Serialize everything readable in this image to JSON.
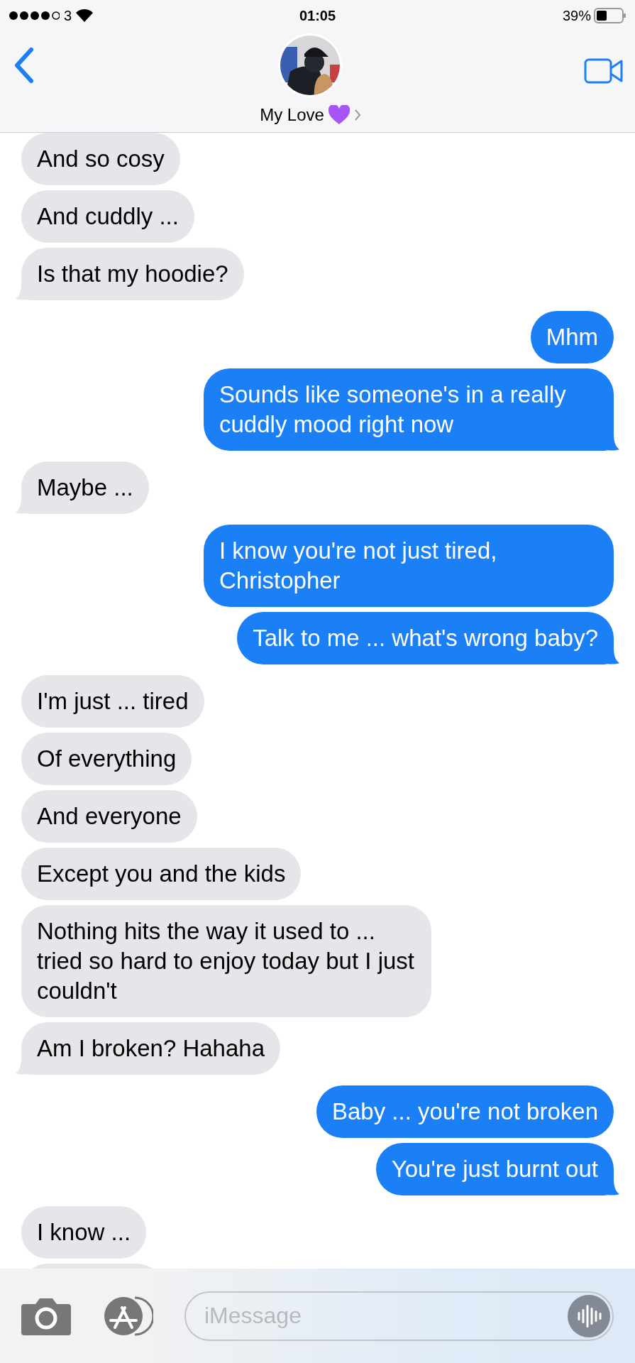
{
  "status_bar": {
    "carrier": "3",
    "time": "01:05",
    "battery": "39%"
  },
  "header": {
    "contact_name": "My Love"
  },
  "messages": [
    {
      "kind": "received",
      "text": "And so cosy",
      "tail": false
    },
    {
      "kind": "received",
      "text": "And cuddly ...",
      "tail": false
    },
    {
      "kind": "received",
      "text": "Is that my hoodie?",
      "tail": true
    },
    {
      "kind": "sent",
      "text": "Mhm",
      "tail": false
    },
    {
      "kind": "sent",
      "text": "Sounds like someone's in a really cuddly mood right now",
      "tail": true
    },
    {
      "kind": "received",
      "text": "Maybe ...",
      "tail": true
    },
    {
      "kind": "sent",
      "text": "I know you're not just tired, Christopher",
      "tail": false
    },
    {
      "kind": "sent",
      "text": "Talk to me ... what's wrong baby?",
      "tail": true
    },
    {
      "kind": "received",
      "text": "I'm just ... tired",
      "tail": false
    },
    {
      "kind": "received",
      "text": "Of everything",
      "tail": false
    },
    {
      "kind": "received",
      "text": "And everyone",
      "tail": false
    },
    {
      "kind": "received",
      "text": "Except you and the kids",
      "tail": false
    },
    {
      "kind": "received",
      "text": "Nothing hits the way it used to ... tried so hard to enjoy today but I just couldn't",
      "tail": false
    },
    {
      "kind": "received",
      "text": "Am I broken? Hahaha",
      "tail": true
    },
    {
      "kind": "sent",
      "text": "Baby ... you're not broken",
      "tail": false
    },
    {
      "kind": "sent",
      "text": "You're just burnt out",
      "tail": true
    },
    {
      "kind": "received",
      "text": "I know ...",
      "tail": false
    },
    {
      "kind": "received"
    }
  ],
  "compose": {
    "placeholder": "iMessage"
  }
}
